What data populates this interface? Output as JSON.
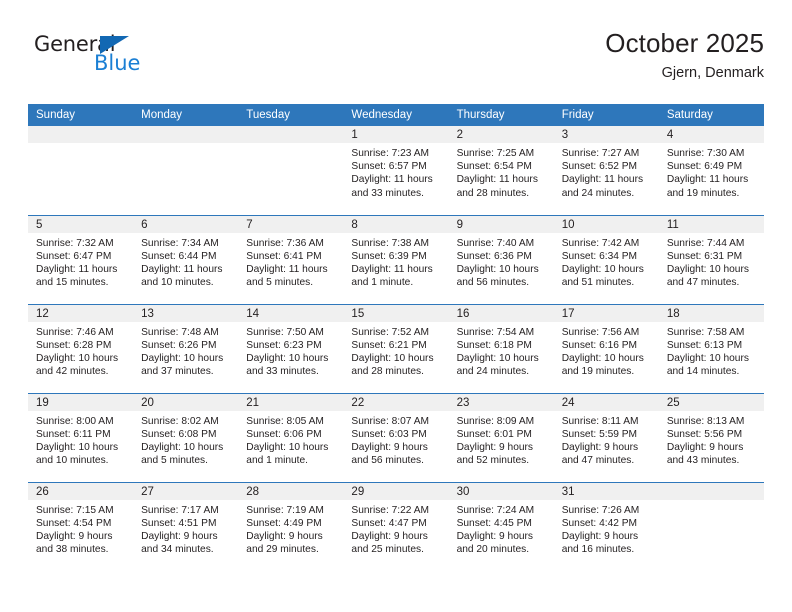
{
  "brand": {
    "word_one": "General",
    "word_two": "Blue",
    "triangle_icon": "triangle-icon",
    "accent_dark": "#1268b3",
    "accent_light": "#1b7fd4"
  },
  "header": {
    "title": "October 2025",
    "subtitle": "Gjern, Denmark"
  },
  "theme": {
    "header_blue": "#2e77bb",
    "daynum_band": "#f0f0f0",
    "text": "#231f20"
  },
  "weekday_headers": [
    "Sunday",
    "Monday",
    "Tuesday",
    "Wednesday",
    "Thursday",
    "Friday",
    "Saturday"
  ],
  "weeks": [
    [
      {
        "day": "",
        "sunrise": "",
        "sunset": "",
        "daylight": "",
        "empty": true
      },
      {
        "day": "",
        "sunrise": "",
        "sunset": "",
        "daylight": "",
        "empty": true
      },
      {
        "day": "",
        "sunrise": "",
        "sunset": "",
        "daylight": "",
        "empty": true
      },
      {
        "day": "1",
        "sunrise": "Sunrise: 7:23 AM",
        "sunset": "Sunset: 6:57 PM",
        "daylight": "Daylight: 11 hours and 33 minutes."
      },
      {
        "day": "2",
        "sunrise": "Sunrise: 7:25 AM",
        "sunset": "Sunset: 6:54 PM",
        "daylight": "Daylight: 11 hours and 28 minutes."
      },
      {
        "day": "3",
        "sunrise": "Sunrise: 7:27 AM",
        "sunset": "Sunset: 6:52 PM",
        "daylight": "Daylight: 11 hours and 24 minutes."
      },
      {
        "day": "4",
        "sunrise": "Sunrise: 7:30 AM",
        "sunset": "Sunset: 6:49 PM",
        "daylight": "Daylight: 11 hours and 19 minutes."
      }
    ],
    [
      {
        "day": "5",
        "sunrise": "Sunrise: 7:32 AM",
        "sunset": "Sunset: 6:47 PM",
        "daylight": "Daylight: 11 hours and 15 minutes."
      },
      {
        "day": "6",
        "sunrise": "Sunrise: 7:34 AM",
        "sunset": "Sunset: 6:44 PM",
        "daylight": "Daylight: 11 hours and 10 minutes."
      },
      {
        "day": "7",
        "sunrise": "Sunrise: 7:36 AM",
        "sunset": "Sunset: 6:41 PM",
        "daylight": "Daylight: 11 hours and 5 minutes."
      },
      {
        "day": "8",
        "sunrise": "Sunrise: 7:38 AM",
        "sunset": "Sunset: 6:39 PM",
        "daylight": "Daylight: 11 hours and 1 minute."
      },
      {
        "day": "9",
        "sunrise": "Sunrise: 7:40 AM",
        "sunset": "Sunset: 6:36 PM",
        "daylight": "Daylight: 10 hours and 56 minutes."
      },
      {
        "day": "10",
        "sunrise": "Sunrise: 7:42 AM",
        "sunset": "Sunset: 6:34 PM",
        "daylight": "Daylight: 10 hours and 51 minutes."
      },
      {
        "day": "11",
        "sunrise": "Sunrise: 7:44 AM",
        "sunset": "Sunset: 6:31 PM",
        "daylight": "Daylight: 10 hours and 47 minutes."
      }
    ],
    [
      {
        "day": "12",
        "sunrise": "Sunrise: 7:46 AM",
        "sunset": "Sunset: 6:28 PM",
        "daylight": "Daylight: 10 hours and 42 minutes."
      },
      {
        "day": "13",
        "sunrise": "Sunrise: 7:48 AM",
        "sunset": "Sunset: 6:26 PM",
        "daylight": "Daylight: 10 hours and 37 minutes."
      },
      {
        "day": "14",
        "sunrise": "Sunrise: 7:50 AM",
        "sunset": "Sunset: 6:23 PM",
        "daylight": "Daylight: 10 hours and 33 minutes."
      },
      {
        "day": "15",
        "sunrise": "Sunrise: 7:52 AM",
        "sunset": "Sunset: 6:21 PM",
        "daylight": "Daylight: 10 hours and 28 minutes."
      },
      {
        "day": "16",
        "sunrise": "Sunrise: 7:54 AM",
        "sunset": "Sunset: 6:18 PM",
        "daylight": "Daylight: 10 hours and 24 minutes."
      },
      {
        "day": "17",
        "sunrise": "Sunrise: 7:56 AM",
        "sunset": "Sunset: 6:16 PM",
        "daylight": "Daylight: 10 hours and 19 minutes."
      },
      {
        "day": "18",
        "sunrise": "Sunrise: 7:58 AM",
        "sunset": "Sunset: 6:13 PM",
        "daylight": "Daylight: 10 hours and 14 minutes."
      }
    ],
    [
      {
        "day": "19",
        "sunrise": "Sunrise: 8:00 AM",
        "sunset": "Sunset: 6:11 PM",
        "daylight": "Daylight: 10 hours and 10 minutes."
      },
      {
        "day": "20",
        "sunrise": "Sunrise: 8:02 AM",
        "sunset": "Sunset: 6:08 PM",
        "daylight": "Daylight: 10 hours and 5 minutes."
      },
      {
        "day": "21",
        "sunrise": "Sunrise: 8:05 AM",
        "sunset": "Sunset: 6:06 PM",
        "daylight": "Daylight: 10 hours and 1 minute."
      },
      {
        "day": "22",
        "sunrise": "Sunrise: 8:07 AM",
        "sunset": "Sunset: 6:03 PM",
        "daylight": "Daylight: 9 hours and 56 minutes."
      },
      {
        "day": "23",
        "sunrise": "Sunrise: 8:09 AM",
        "sunset": "Sunset: 6:01 PM",
        "daylight": "Daylight: 9 hours and 52 minutes."
      },
      {
        "day": "24",
        "sunrise": "Sunrise: 8:11 AM",
        "sunset": "Sunset: 5:59 PM",
        "daylight": "Daylight: 9 hours and 47 minutes."
      },
      {
        "day": "25",
        "sunrise": "Sunrise: 8:13 AM",
        "sunset": "Sunset: 5:56 PM",
        "daylight": "Daylight: 9 hours and 43 minutes."
      }
    ],
    [
      {
        "day": "26",
        "sunrise": "Sunrise: 7:15 AM",
        "sunset": "Sunset: 4:54 PM",
        "daylight": "Daylight: 9 hours and 38 minutes."
      },
      {
        "day": "27",
        "sunrise": "Sunrise: 7:17 AM",
        "sunset": "Sunset: 4:51 PM",
        "daylight": "Daylight: 9 hours and 34 minutes."
      },
      {
        "day": "28",
        "sunrise": "Sunrise: 7:19 AM",
        "sunset": "Sunset: 4:49 PM",
        "daylight": "Daylight: 9 hours and 29 minutes."
      },
      {
        "day": "29",
        "sunrise": "Sunrise: 7:22 AM",
        "sunset": "Sunset: 4:47 PM",
        "daylight": "Daylight: 9 hours and 25 minutes."
      },
      {
        "day": "30",
        "sunrise": "Sunrise: 7:24 AM",
        "sunset": "Sunset: 4:45 PM",
        "daylight": "Daylight: 9 hours and 20 minutes."
      },
      {
        "day": "31",
        "sunrise": "Sunrise: 7:26 AM",
        "sunset": "Sunset: 4:42 PM",
        "daylight": "Daylight: 9 hours and 16 minutes."
      },
      {
        "day": "",
        "sunrise": "",
        "sunset": "",
        "daylight": "",
        "empty": true
      }
    ]
  ]
}
